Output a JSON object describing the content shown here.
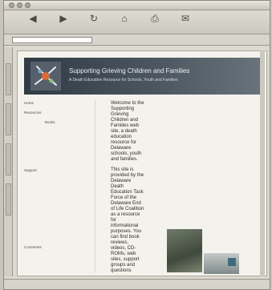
{
  "window": {
    "title": ""
  },
  "toolbar": {
    "buttons": [
      {
        "icon": "back-arrow-icon",
        "label": ""
      },
      {
        "icon": "forward-arrow-icon",
        "label": ""
      },
      {
        "icon": "reload-icon",
        "label": ""
      },
      {
        "icon": "home-icon",
        "label": ""
      },
      {
        "icon": "print-icon",
        "label": ""
      },
      {
        "icon": "mail-icon",
        "label": ""
      }
    ]
  },
  "address": {
    "label": "",
    "url": ""
  },
  "banner": {
    "heading": "Supporting Grieving Children and Families",
    "subheading": "A Death Education Resource for Schools, Youth and Families"
  },
  "nav": {
    "items": [
      {
        "label": "Home",
        "level": "head"
      },
      {
        "label": "Resources",
        "level": "head"
      },
      {
        "label": "Books",
        "level": "sub"
      },
      {
        "label": "",
        "level": "sub"
      },
      {
        "label": "",
        "level": "sub"
      },
      {
        "label": "",
        "level": "sub"
      },
      {
        "label": "",
        "level": "sub"
      },
      {
        "label": "Support",
        "level": "head"
      },
      {
        "label": "",
        "level": "sub"
      },
      {
        "label": "",
        "level": "sub"
      },
      {
        "label": "",
        "level": "sub"
      },
      {
        "label": "",
        "level": "sub"
      },
      {
        "label": "",
        "level": "sub"
      },
      {
        "label": "",
        "level": "sub"
      },
      {
        "label": "",
        "level": "sub"
      },
      {
        "label": "Comments",
        "level": "head"
      }
    ]
  },
  "main": {
    "intro": "Welcome to the Supporting Grieving Children and Families web site, a death education resource for Delaware schools, youth and families.",
    "provided": "This site is provided by the Delaware Death Education Task Force of the Delaware End of Life Coalition as a resource for informational purposes. You can find book reviews, videos, CD-ROMs, web sites, support groups and questions"
  },
  "status": {
    "text": ""
  }
}
